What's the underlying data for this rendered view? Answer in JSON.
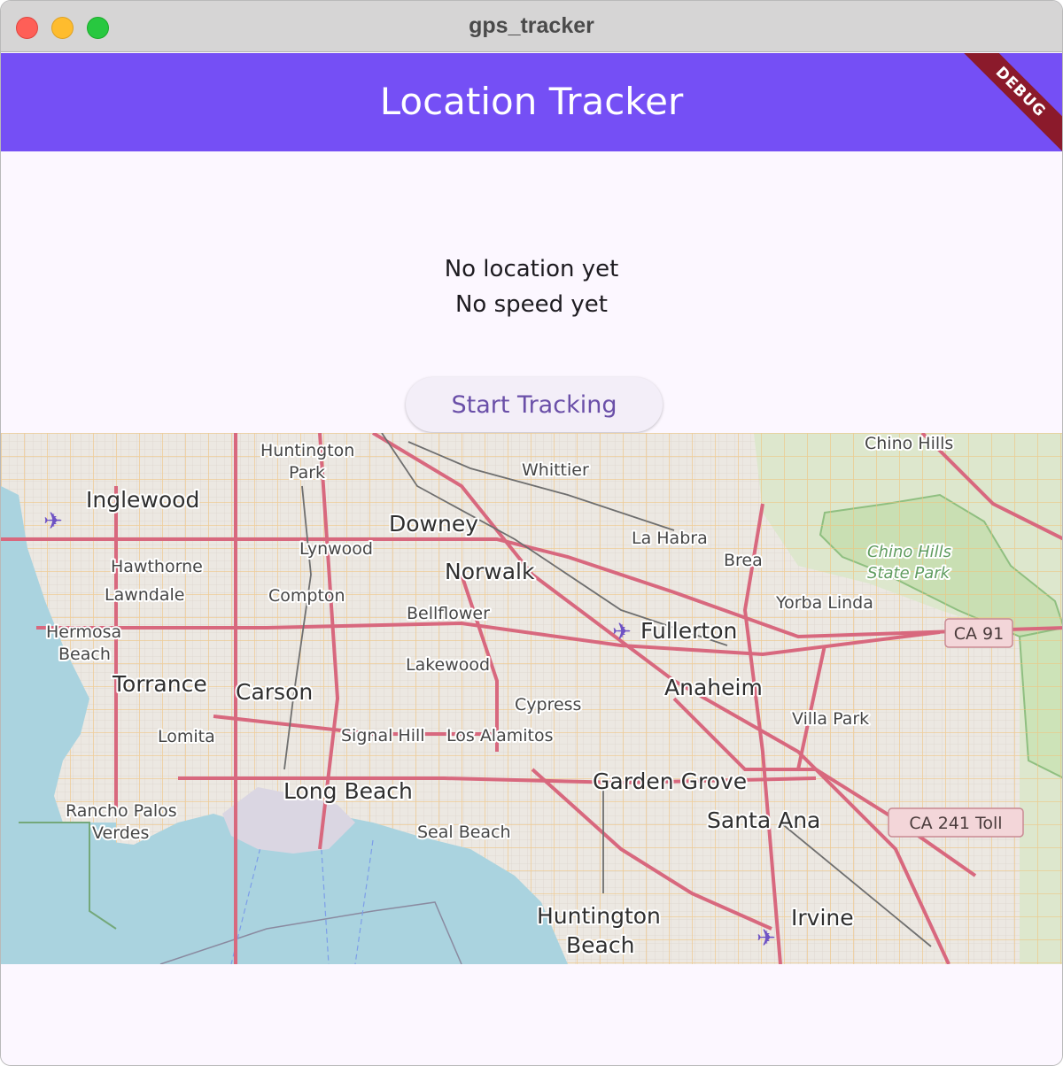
{
  "window": {
    "title": "gps_tracker"
  },
  "appbar": {
    "title": "Location Tracker",
    "debug_banner": "DEBUG"
  },
  "status": {
    "location": "No location yet",
    "speed": "No speed yet"
  },
  "actions": {
    "start_tracking": "Start Tracking"
  },
  "map": {
    "labels": {
      "inglewood": "Inglewood",
      "huntington_park_1": "Huntington",
      "huntington_park_2": "Park",
      "whittier": "Whittier",
      "chino_hills": "Chino Hills",
      "downey": "Downey",
      "hawthorne": "Hawthorne",
      "lynwood": "Lynwood",
      "la_habra": "La Habra",
      "norwalk": "Norwalk",
      "brea": "Brea",
      "chino_hills_park_1": "Chino Hills",
      "chino_hills_park_2": "State Park",
      "lawndale": "Lawndale",
      "compton": "Compton",
      "bellflower": "Bellflower",
      "yorba_linda": "Yorba Linda",
      "hermosa_1": "Hermosa",
      "hermosa_2": "Beach",
      "fullerton": "Fullerton",
      "lakewood": "Lakewood",
      "torrance": "Torrance",
      "carson": "Carson",
      "anaheim": "Anaheim",
      "cypress": "Cypress",
      "villa_park": "Villa Park",
      "lomita": "Lomita",
      "signal_hill": "Signal Hill",
      "los_alamitos": "Los Alamitos",
      "long_beach": "Long Beach",
      "garden_grove": "Garden Grove",
      "rancho_1": "Rancho Palos",
      "rancho_2": "Verdes",
      "seal_beach": "Seal Beach",
      "santa_ana": "Santa Ana",
      "huntington_beach_1": "Huntington",
      "huntington_beach_2": "Beach",
      "irvine": "Irvine"
    },
    "shields": {
      "ca91": "CA 91",
      "ca241": "CA 241 Toll"
    }
  },
  "colors": {
    "appbar": "#754ff5",
    "ocean": "#aad3df",
    "land": "#f2efe9",
    "park": "#cde3b8",
    "major_road": "#d8687e",
    "minor_road": "#f6c97a"
  }
}
